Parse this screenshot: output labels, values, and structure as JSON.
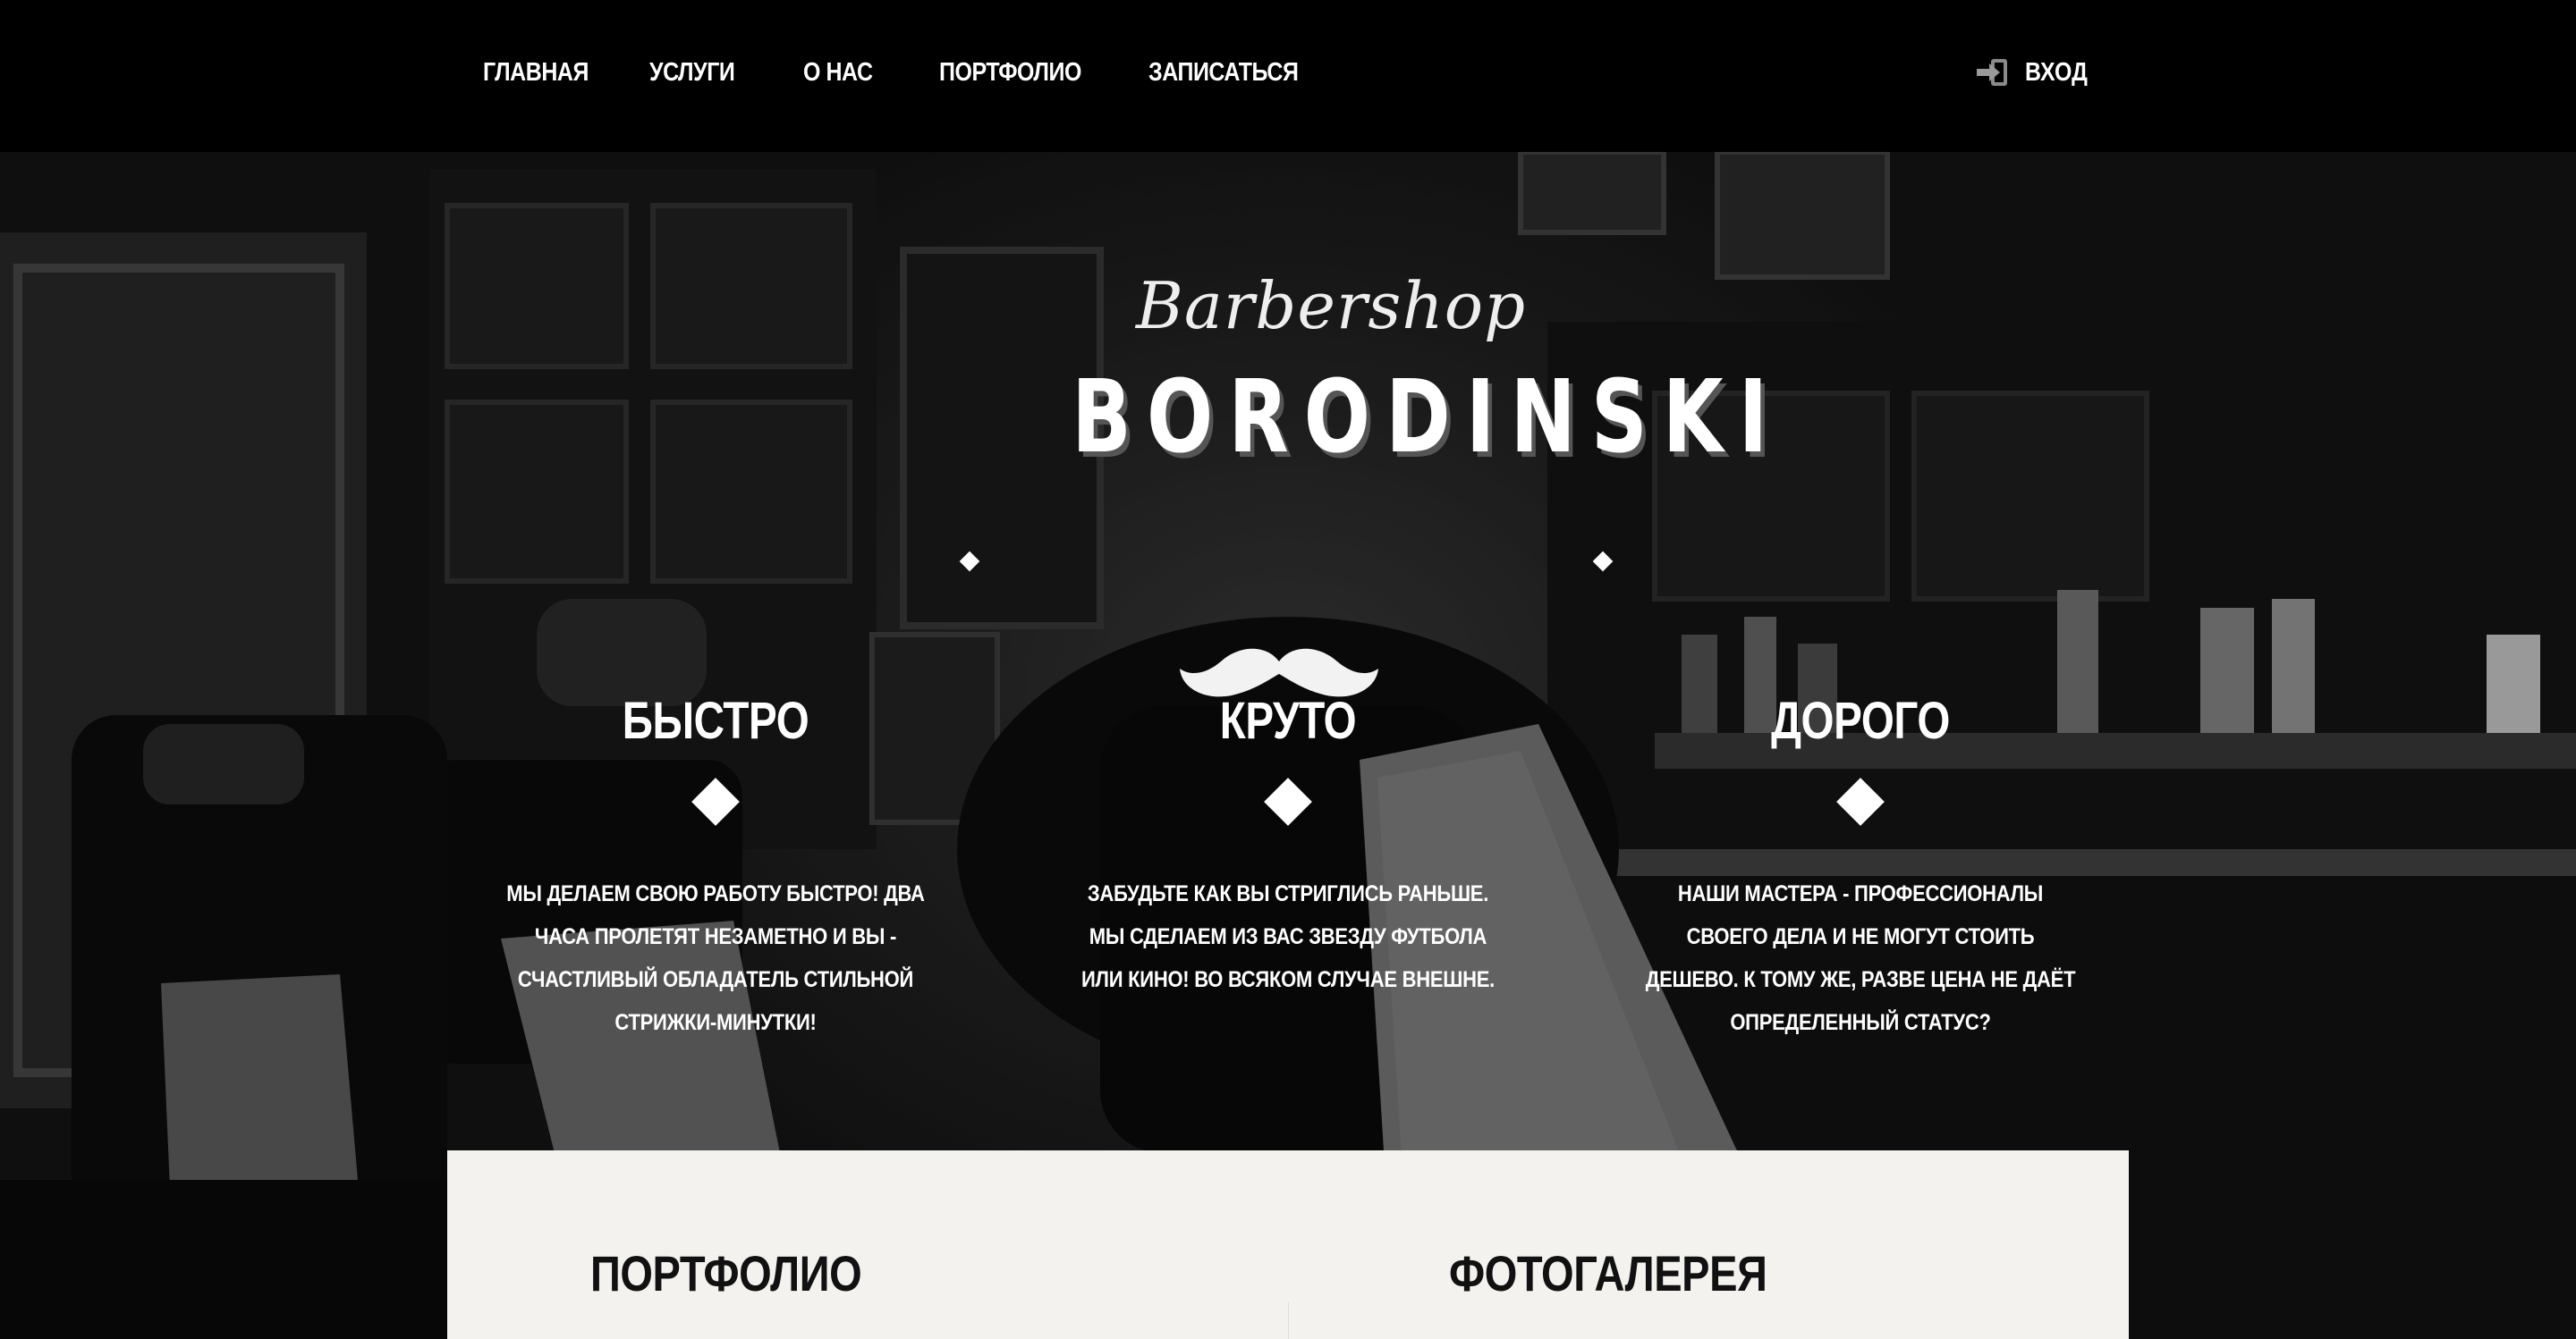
{
  "nav": {
    "items": [
      {
        "label": "ГЛАВНАЯ"
      },
      {
        "label": "УСЛУГИ"
      },
      {
        "label": "О НАС"
      },
      {
        "label": "ПОРТФОЛИО"
      },
      {
        "label": "ЗАПИСАТЬСЯ"
      }
    ],
    "login": {
      "label": "ВХОД",
      "icon": "login-icon"
    }
  },
  "brand": {
    "script": "Barbershop",
    "name": "BORODINSKI",
    "logo_icon": "mustache-icon"
  },
  "features": [
    {
      "title": "БЫСТРО",
      "text": "МЫ ДЕЛАЕМ СВОЮ РАБОТУ БЫСТРО! ДВА ЧАСА ПРОЛЕТЯТ НЕЗАМЕТНО И ВЫ - СЧАСТЛИВЫЙ ОБЛАДАТЕЛЬ СТИЛЬНОЙ СТРИЖКИ-МИНУТКИ!"
    },
    {
      "title": "КРУТО",
      "text": "ЗАБУДЬТЕ КАК ВЫ СТРИГЛИСЬ РАНЬШЕ. МЫ СДЕЛАЕМ ИЗ ВАС ЗВЕЗДУ ФУТБОЛА ИЛИ КИНО! ВО ВСЯКОМ СЛУЧАЕ ВНЕШНЕ."
    },
    {
      "title": "ДОРОГО",
      "text": "НАШИ МАСТЕРА - ПРОФЕССИОНАЛЫ СВОЕГО ДЕЛА И НЕ МОГУТ СТОИТЬ ДЕШЕВО. К ТОМУ ЖЕ, РАЗВЕ ЦЕНА НЕ ДАЁТ ОПРЕДЕЛЕННЫЙ СТАТУС?"
    }
  ],
  "sections": {
    "portfolio": "ПОРТФОЛИО",
    "gallery": "ФОТОГАЛЕРЕЯ"
  },
  "colors": {
    "nav_bg": "#000000",
    "panel_bg": "#f4f2ee",
    "text_light": "#ffffff",
    "text_dark": "#111111"
  }
}
